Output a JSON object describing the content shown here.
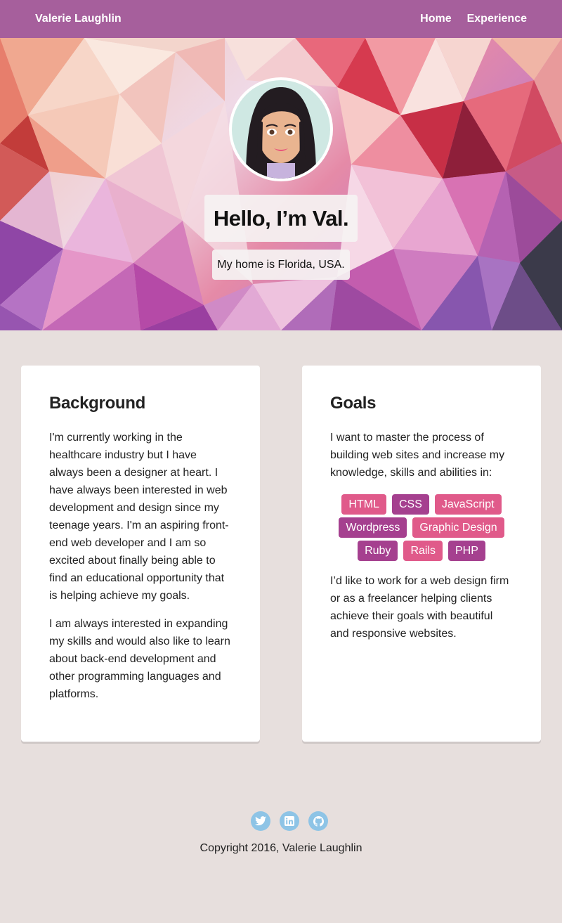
{
  "nav": {
    "brand": "Valerie Laughlin",
    "links": [
      "Home",
      "Experience"
    ]
  },
  "hero": {
    "title": "Hello, I’m Val.",
    "subtitle": "My home is Florida, USA."
  },
  "background_card": {
    "heading": "Background",
    "paragraphs": [
      "I'm currently working in the healthcare industry but I have always been a designer at heart. I have always been interested in web development and design since my teenage years. I'm an aspiring front-end web developer and I am so excited about finally being able to find an educational opportunity that is helping achieve my goals.",
      "I am always interested in expanding my skills and would also like to learn about back-end development and other programming languages and platforms."
    ]
  },
  "goals_card": {
    "heading": "Goals",
    "intro": "I want to master the process of building web sites and increase my knowledge, skills and abilities in:",
    "skills": [
      "HTML",
      "CSS",
      "JavaScript",
      "Wordpress",
      "Graphic Design",
      "Ruby",
      "Rails",
      "PHP"
    ],
    "outro": "I’d like to work for a web design firm or as a freelancer helping clients achieve their goals with beautiful and responsive websites."
  },
  "footer": {
    "social_icons": [
      "twitter-icon",
      "linkedin-icon",
      "github-icon"
    ],
    "copyright": "Copyright 2016, Valerie Laughlin"
  },
  "colors": {
    "nav_bg": "#a65f9c",
    "page_bg": "#e7dfdd",
    "tag_pink": "#e05a8a",
    "tag_purple": "#a5408f",
    "social_icon": "#8ec4e6"
  }
}
